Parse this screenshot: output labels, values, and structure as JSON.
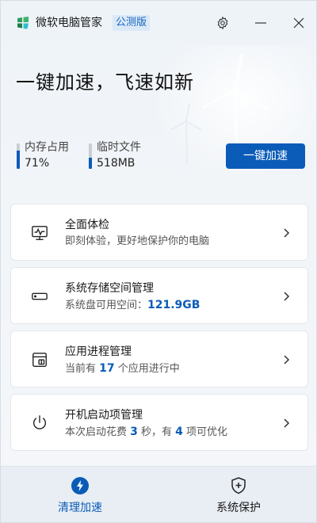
{
  "titlebar": {
    "app_title": "微软电脑管家",
    "badge": "公测版",
    "logo_icon": "pc-manager-logo",
    "settings_icon": "gear-icon",
    "minimize_icon": "minimize-icon",
    "close_icon": "close-icon"
  },
  "hero": {
    "title": "一键加速，飞速如新",
    "memory": {
      "label": "内存占用",
      "value": "71%",
      "fill_fraction": 0.71
    },
    "temp_files": {
      "label": "临时文件",
      "value": "518MB",
      "fill_fraction": 0.45
    },
    "speedup_button": "一键加速",
    "accent_color": "#0b5cb8"
  },
  "cards": [
    {
      "title": "全面体检",
      "sub_text": "即刻体验，更好地保护你的电脑",
      "icon": "monitor-pulse-icon"
    },
    {
      "title": "系统存储空间管理",
      "sub_prefix": "系统盘可用空间：",
      "sub_value": "121.9GB",
      "icon": "storage-drive-icon"
    },
    {
      "title": "应用进程管理",
      "sub_prefix": "当前有 ",
      "sub_value": "17",
      "sub_suffix": " 个应用进行中",
      "icon": "app-process-icon"
    },
    {
      "title": "开机启动项管理",
      "sub_prefix": "本次启动花费 ",
      "sub_value": "3",
      "sub_mid": " 秒，有 ",
      "sub_value2": "4",
      "sub_suffix": " 项可优化",
      "icon": "power-icon"
    }
  ],
  "bottom_nav": {
    "items": [
      {
        "label": "清理加速",
        "icon": "lightning-icon",
        "active": true
      },
      {
        "label": "系统保护",
        "icon": "shield-plus-icon",
        "active": false
      }
    ]
  }
}
